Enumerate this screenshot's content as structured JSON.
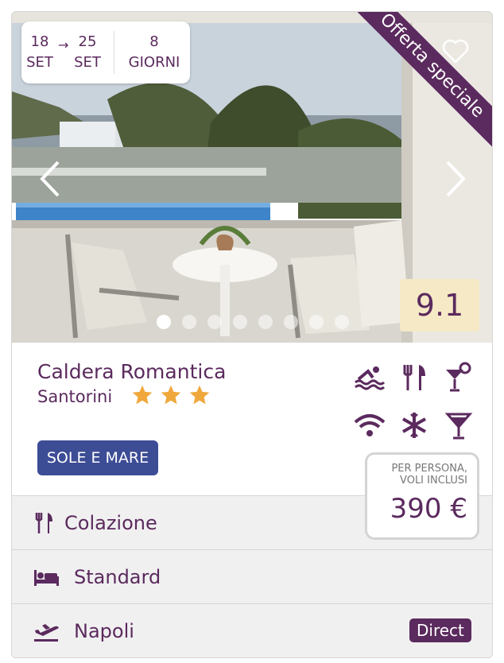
{
  "dates": {
    "from_day": "18",
    "from_month": "SET",
    "to_day": "25",
    "to_month": "SET",
    "nights_count": "8",
    "nights_label": "GIORNI"
  },
  "ribbon": "Offerta speciale",
  "score": "9.1",
  "gallery": {
    "slide_count": 8,
    "active_index": 0
  },
  "hotel": {
    "name": "Caldera Romantica",
    "location": "Santorini",
    "stars": 3
  },
  "amenities": [
    "swimming-pool-icon",
    "restaurant-icon",
    "bar-icon",
    "wifi-icon",
    "air-conditioning-icon",
    "cocktail-icon"
  ],
  "tag": "SOLE E MARE",
  "price": {
    "note": "PER PERSONA, VOLI INCLUSI",
    "value": "390 €"
  },
  "rows": {
    "board": "Colazione",
    "room": "Standard",
    "departure": "Napoli",
    "flight_badge": "Direct"
  },
  "colors": {
    "brand": "#5b2a5e",
    "tag": "#3c4c95",
    "score_bg": "#f5e9c6",
    "star": "#f0a83c"
  }
}
